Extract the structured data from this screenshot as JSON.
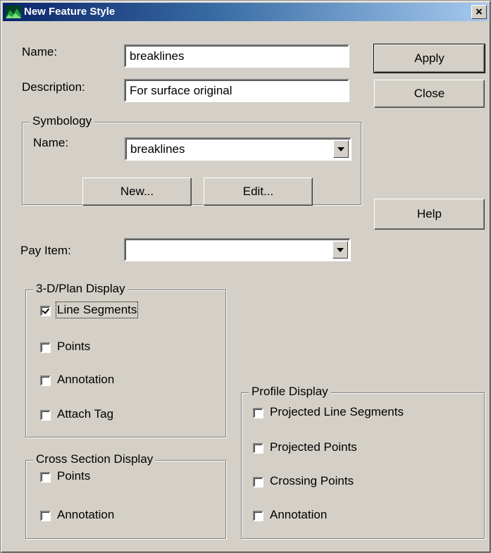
{
  "window": {
    "title": "New Feature Style",
    "close_glyph": "×"
  },
  "fields": {
    "name_label": "Name:",
    "name_value": "breaklines",
    "description_label": "Description:",
    "description_value": "For surface original",
    "pay_item_label": "Pay Item:",
    "pay_item_value": ""
  },
  "buttons": {
    "apply": "Apply",
    "close": "Close",
    "help": "Help"
  },
  "symbology": {
    "title": "Symbology",
    "name_label": "Name:",
    "name_value": "breaklines",
    "new_label": "New...",
    "edit_label": "Edit..."
  },
  "plan_display": {
    "title": "3-D/Plan Display",
    "items": [
      {
        "label": "Line Segments",
        "checked": true
      },
      {
        "label": "Points",
        "checked": false
      },
      {
        "label": "Annotation",
        "checked": false
      },
      {
        "label": "Attach Tag",
        "checked": false
      }
    ]
  },
  "cross_section_display": {
    "title": "Cross Section Display",
    "items": [
      {
        "label": "Points",
        "checked": false
      },
      {
        "label": "Annotation",
        "checked": false
      }
    ]
  },
  "profile_display": {
    "title": "Profile Display",
    "items": [
      {
        "label": "Projected Line Segments",
        "checked": false
      },
      {
        "label": "Projected Points",
        "checked": false
      },
      {
        "label": "Crossing Points",
        "checked": false
      },
      {
        "label": "Annotation",
        "checked": false
      }
    ]
  },
  "icons": {
    "app_icon": "terrain-icon",
    "close_icon": "close-icon",
    "dropdown_icon": "chevron-down-icon",
    "checkmark_icon": "checkmark-icon"
  }
}
